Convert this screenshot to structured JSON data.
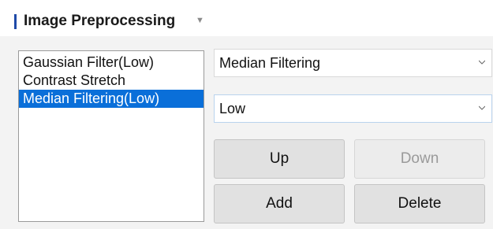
{
  "header": {
    "title": "Image Preprocessing",
    "caret_icon": "dropdown-caret-icon",
    "accent_color": "#1f4aa8"
  },
  "filter_list": {
    "items": [
      {
        "label": "Gaussian Filter(Low)",
        "selected": false
      },
      {
        "label": "Contrast Stretch",
        "selected": false
      },
      {
        "label": "Median Filtering(Low)",
        "selected": true
      }
    ],
    "selection_color": "#0a6fd9"
  },
  "filter_type_select": {
    "value": "Median Filtering",
    "chevron_icon": "chevron-down-icon"
  },
  "strength_select": {
    "value": "Low",
    "chevron_icon": "chevron-down-icon"
  },
  "buttons": {
    "up": "Up",
    "down": "Down",
    "add": "Add",
    "delete": "Delete"
  }
}
